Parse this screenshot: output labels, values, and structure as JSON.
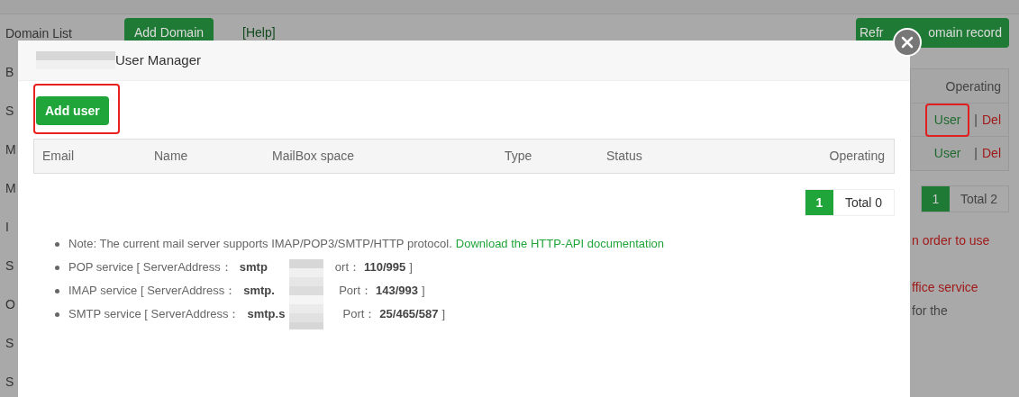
{
  "background": {
    "sidebar": {
      "items": [
        {
          "label": "Domain List"
        },
        {
          "label": "B"
        },
        {
          "label": "S"
        },
        {
          "label": "M"
        },
        {
          "label": "M"
        },
        {
          "label": "I"
        },
        {
          "label": "S"
        },
        {
          "label": "O"
        },
        {
          "label": "S"
        },
        {
          "label": "S"
        }
      ]
    },
    "toolbar": {
      "add_domain": "Add Domain",
      "help": "[Help]",
      "refresh_parts": [
        "Refr",
        "omain record"
      ]
    },
    "table": {
      "header": "Operating",
      "rows": [
        {
          "user": "User",
          "separator": "|",
          "del": "Del",
          "highlighted": true
        },
        {
          "user": "User",
          "separator": "|",
          "del": "Del",
          "highlighted": false
        }
      ]
    },
    "pagination": {
      "page": "1",
      "total": "Total 2"
    },
    "notes": [
      {
        "text": "n order to use",
        "kind": "warning"
      },
      {
        "text": "ffice service",
        "kind": "warning"
      },
      {
        "text": "for the",
        "kind": "plain"
      }
    ]
  },
  "dialog": {
    "title": "User Manager",
    "add_user": "Add user",
    "add_user_highlighted": true,
    "table": {
      "columns": [
        "Email",
        "Name",
        "MailBox space",
        "Type",
        "Status",
        "Operating"
      ]
    },
    "pagination": {
      "page": "1",
      "total": "Total 0"
    },
    "note": {
      "text": "Note: The current mail server supports IMAP/POP3/SMTP/HTTP protocol.",
      "link": "Download the HTTP-API documentation"
    },
    "services": [
      {
        "label": "POP service [ ServerAddress：",
        "server": "smtp",
        "port_label": "ort：",
        "port": "110/995",
        "end": "]"
      },
      {
        "label": "IMAP service [ ServerAddress：",
        "server": "smtp.",
        "port_label": "Port：",
        "port": "143/993",
        "end": "]"
      },
      {
        "label": "SMTP service [ ServerAddress：",
        "server": "smtp.s",
        "port_label": "Port：",
        "port": "25/465/587",
        "end": "]"
      }
    ]
  }
}
